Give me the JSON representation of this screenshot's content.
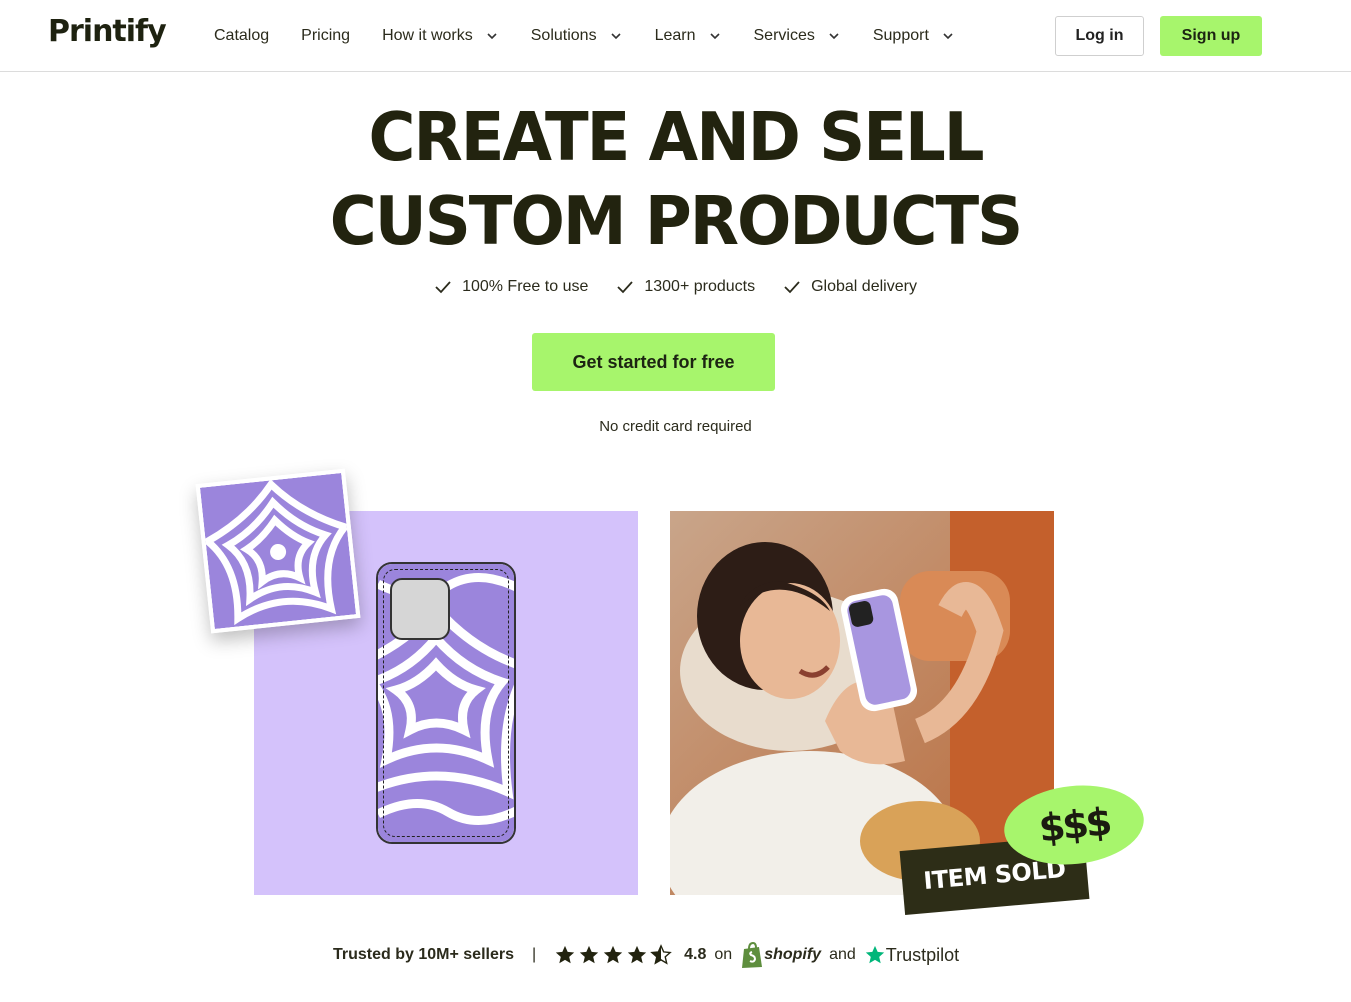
{
  "header": {
    "logo": "Printify",
    "nav": [
      {
        "label": "Catalog",
        "dropdown": false
      },
      {
        "label": "Pricing",
        "dropdown": false
      },
      {
        "label": "How it works",
        "dropdown": true
      },
      {
        "label": "Solutions",
        "dropdown": true
      },
      {
        "label": "Learn",
        "dropdown": true
      },
      {
        "label": "Services",
        "dropdown": true
      },
      {
        "label": "Support",
        "dropdown": true
      }
    ],
    "login_label": "Log in",
    "signup_label": "Sign up"
  },
  "hero": {
    "title_line1": "CREATE AND SELL",
    "title_line2": "CUSTOM PRODUCTS",
    "features": [
      "100% Free to use",
      "1300+ products",
      "Global delivery"
    ],
    "cta_label": "Get started for free",
    "cta_note": "No credit card required"
  },
  "visuals": {
    "sold_label": "ITEM SOLD",
    "money_label": "$$$"
  },
  "trust": {
    "sellers": "Trusted by 10M+ sellers",
    "separator": "|",
    "rating": "4.8",
    "on": "on",
    "shopify": "shopify",
    "and": "and",
    "trustpilot": "Trustpilot"
  },
  "colors": {
    "accent": "#a7f56c",
    "dark": "#22230f",
    "lavender": "#d4c2fb",
    "swirl": "#9b85dc"
  }
}
